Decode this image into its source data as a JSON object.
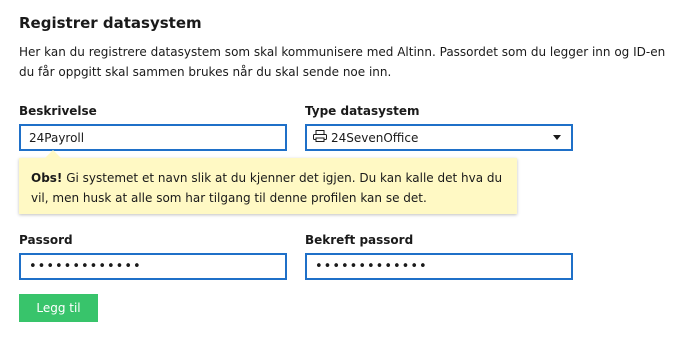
{
  "page": {
    "title": "Registrer datasystem",
    "intro": "Her kan du registrere datasystem som skal kommunisere med Altinn. Passordet som du legger inn og ID-en du får oppgitt skal sammen brukes når du skal sende noe inn."
  },
  "form": {
    "description_label": "Beskrivelse",
    "description_value": "24Payroll",
    "system_type_label": "Type datasystem",
    "system_type_value": "24SevenOffice",
    "system_type_icon": "printer-icon",
    "tip_strong": "Obs!",
    "tip_text": " Gi systemet et navn slik at du kjenner det igjen. Du kan kalle det hva du vil, men husk at alle som har tilgang til denne profilen kan se det.",
    "password_label": "Passord",
    "password_value": "•••••••••••••",
    "confirm_password_label": "Bekreft passord",
    "confirm_password_value": "•••••••••••••",
    "submit_label": "Legg til"
  },
  "colors": {
    "field_border": "#1f70c8",
    "tip_background": "#fff9c4",
    "submit_background": "#38c46b"
  }
}
